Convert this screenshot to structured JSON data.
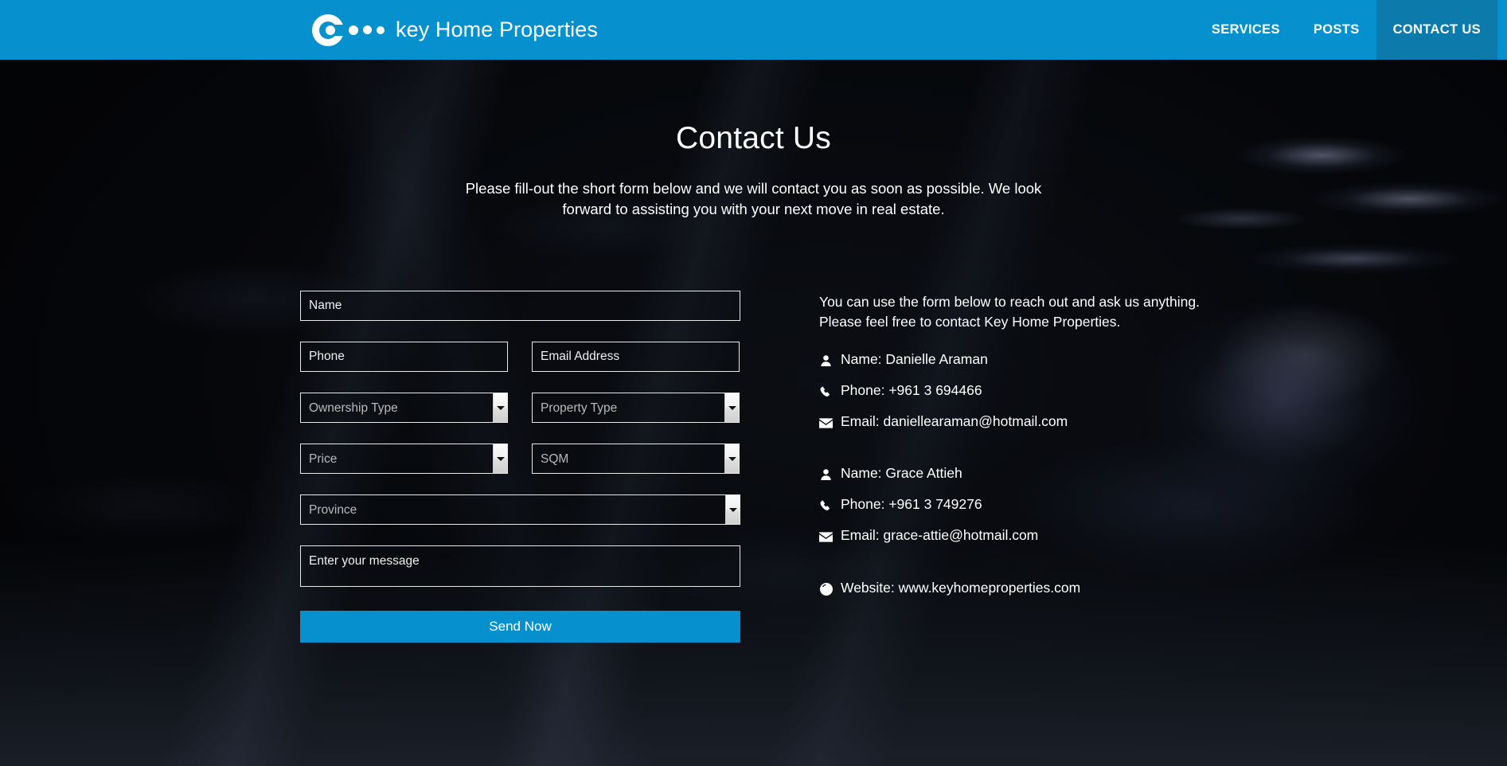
{
  "header": {
    "brand_name": "key Home Properties",
    "logo_icon": "key-circle-logo-icon",
    "nav": [
      {
        "label": "SERVICES",
        "active": false
      },
      {
        "label": "POSTS",
        "active": false
      },
      {
        "label": "CONTACT US",
        "active": true
      }
    ]
  },
  "hero": {
    "title": "Contact Us",
    "subtitle": "Please fill-out the short form below and we will contact you as soon as possible. We look forward to assisting you with your next move in real estate."
  },
  "form": {
    "name_placeholder": "Name",
    "phone_placeholder": "Phone",
    "email_placeholder": "Email Address",
    "ownership_type_placeholder": "Ownership Type",
    "property_type_placeholder": "Property Type",
    "price_placeholder": "Price",
    "sqm_placeholder": "SQM",
    "province_placeholder": "Province",
    "message_placeholder": "Enter your message",
    "submit_label": "Send Now",
    "name_value": "",
    "phone_value": "",
    "email_value": "",
    "message_value": "",
    "ownership_type_selected": "Ownership Type",
    "property_type_selected": "Property Type",
    "price_selected": "Price",
    "sqm_selected": "SQM",
    "province_selected": "Province"
  },
  "info": {
    "intro": "You can use the form below to reach out and ask us anything. Please feel free to contact Key Home Properties.",
    "contacts": [
      {
        "name_line": "Name: Danielle Araman",
        "phone_line": "Phone: +961 3 694466",
        "email_line": "Email: daniellearaman@hotmail.com",
        "name_icon": "user-icon",
        "phone_icon": "phone-icon",
        "email_icon": "envelope-icon"
      },
      {
        "name_line": "Name: Grace Attieh",
        "phone_line": "Phone: +961 3 749276",
        "email_line": "Email: grace-attie@hotmail.com",
        "name_icon": "user-icon",
        "phone_icon": "phone-icon",
        "email_icon": "envelope-icon"
      }
    ],
    "website_line": "Website: www.keyhomeproperties.com",
    "website_icon": "globe-icon"
  },
  "colors": {
    "brand_blue": "#0690cd",
    "active_nav_blue": "#0d7aac",
    "text_white": "#ffffff",
    "field_border": "#e9e9e9",
    "select_text": "#b9b9b9",
    "page_dark": "#05080c"
  }
}
